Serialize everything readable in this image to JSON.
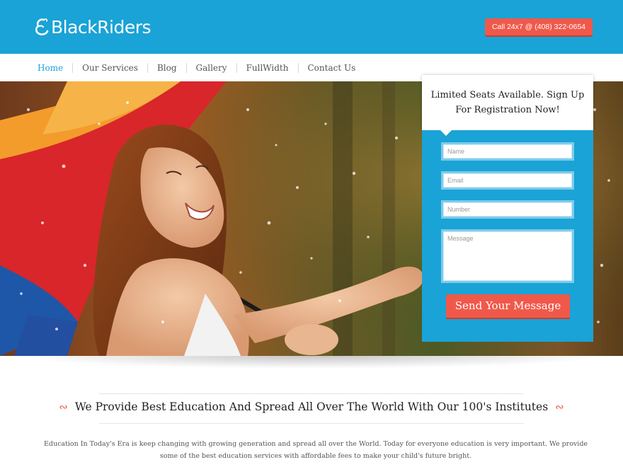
{
  "header": {
    "logo_text": "BlackRiders",
    "call_label": "Call 24x7 @ (408) 322-0654"
  },
  "nav": {
    "items": [
      {
        "label": "Home",
        "active": true
      },
      {
        "label": "Our Services",
        "active": false
      },
      {
        "label": "Blog",
        "active": false
      },
      {
        "label": "Gallery",
        "active": false
      },
      {
        "label": "FullWidth",
        "active": false
      },
      {
        "label": "Contact Us",
        "active": false
      }
    ]
  },
  "form": {
    "title": "Limited Seats Available. Sign Up For Registration Now!",
    "name_placeholder": "Name",
    "email_placeholder": "Email",
    "number_placeholder": "Number",
    "message_placeholder": "Message",
    "submit_label": "Send Your Message"
  },
  "content": {
    "heading": "We Provide Best Education And Spread All Over The World With Our 100's Institutes",
    "description": "Education In Today's Era is keep changing with growing generation and spread all over the World. Today for everyone education is very important. We provide some of the best education services with affordable fees to make your child's future bright."
  },
  "colors": {
    "brand_blue": "#1aa3d6",
    "accent_red": "#f0594a"
  }
}
